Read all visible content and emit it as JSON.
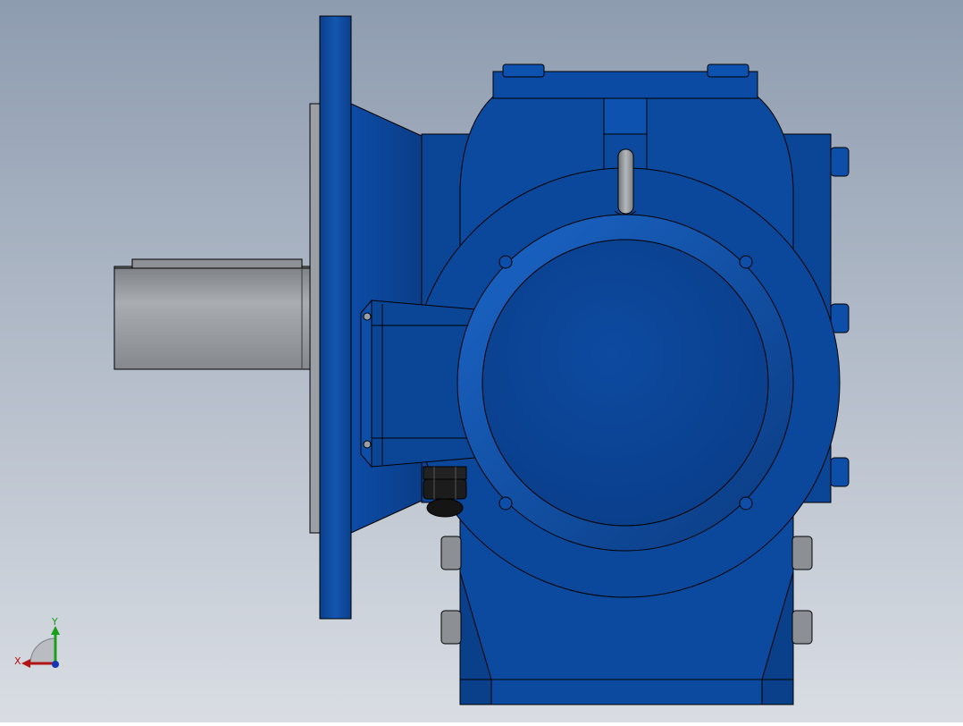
{
  "scene": {
    "background_top": "#8e9cb0",
    "background_bottom": "#d9dde3",
    "body_color": "#0b4a9e",
    "body_dark": "#08306b",
    "body_light": "#1a63c4",
    "shaft_color": "#9a9ea2",
    "shaft_dark": "#6f7377",
    "gland_color": "#1c1c1c"
  },
  "triad": {
    "x_label": "X",
    "y_label": "Y",
    "x_color": "#b01414",
    "y_color": "#19a019",
    "z_color": "#1436b0"
  }
}
